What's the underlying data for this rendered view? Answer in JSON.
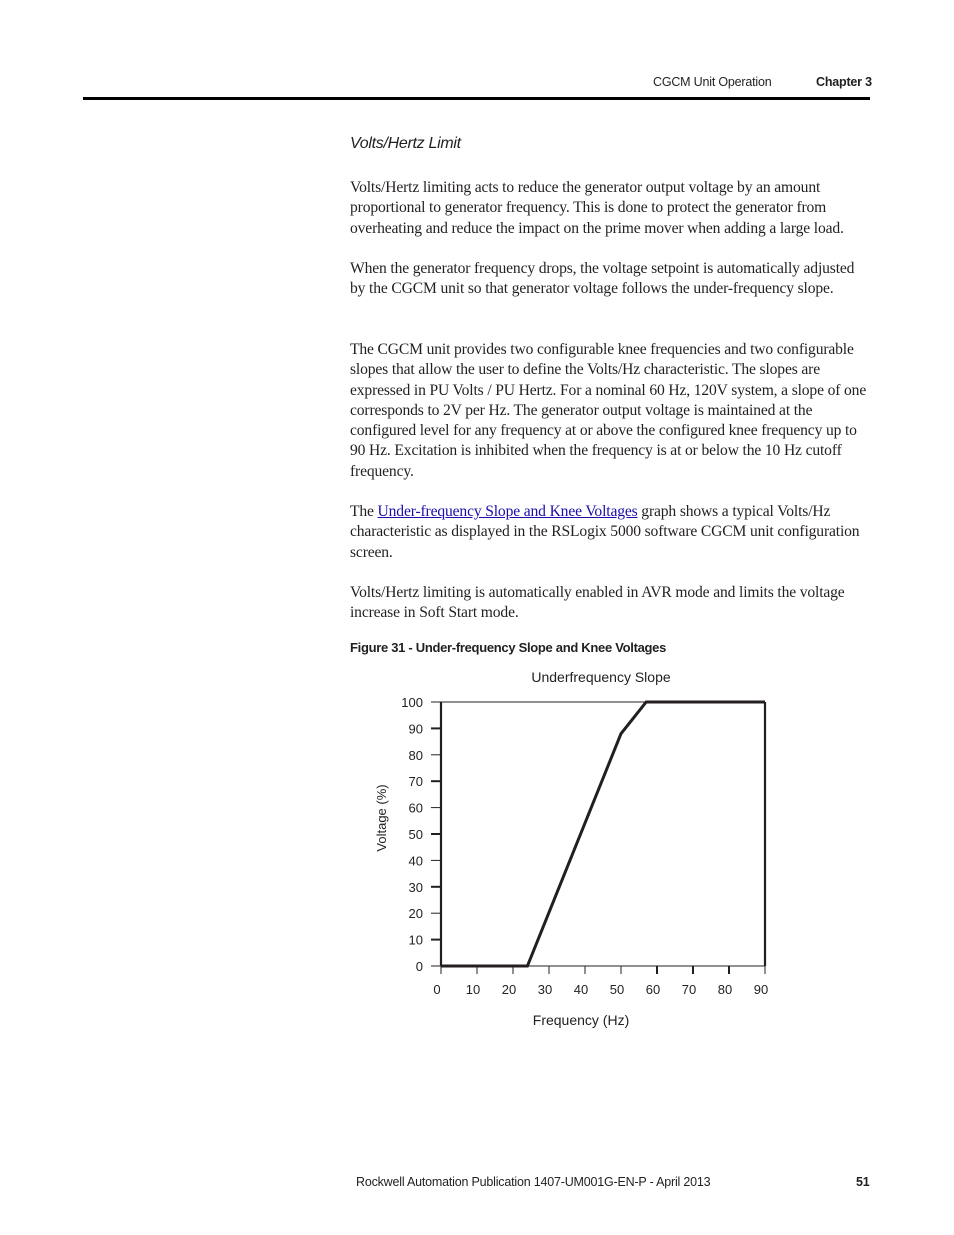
{
  "header": {
    "section": "CGCM Unit Operation",
    "chapter": "Chapter 3"
  },
  "content": {
    "section_title": "Volts/Hertz Limit",
    "paragraphs": [
      "Volts/Hertz limiting acts to reduce the generator output voltage by an amount proportional to generator frequency. This is done to protect the generator from overheating and reduce the impact on the prime mover when adding a large load.",
      "When the generator frequency drops, the voltage setpoint is automatically adjusted by the CGCM unit so that generator voltage follows the under-frequency slope.",
      "The CGCM unit provides two configurable knee frequencies and two configurable slopes that allow the user to define the Volts/Hz characteristic. The slopes are expressed in PU Volts / PU Hertz. For a nominal 60 Hz, 120V system, a slope of one corresponds to 2V per Hz. The generator output voltage is maintained at the configured level for any frequency at or above the configured knee frequency up to 90 Hz. Excitation is inhibited when the frequency is at or below the 10 Hz cutoff frequency.",
      {
        "prefix": "The ",
        "link": "Under-frequency Slope and Knee Voltages",
        "suffix": " graph shows a typical Volts/Hz characteristic as displayed in the RSLogix 5000 software CGCM unit configuration screen."
      },
      "Volts/Hertz limiting is automatically enabled in AVR mode and limits the voltage increase in Soft Start mode."
    ],
    "figure_caption": "Figure 31 - Under-frequency Slope and Knee Voltages"
  },
  "chart_data": {
    "type": "line",
    "title": "Underfrequency Slope",
    "xlabel": "Frequency (Hz)",
    "ylabel": "Voltage (%)",
    "xlim": [
      0,
      90
    ],
    "ylim": [
      0,
      100
    ],
    "x_ticks": [
      0,
      10,
      20,
      30,
      40,
      50,
      60,
      70,
      80,
      90
    ],
    "y_ticks": [
      0,
      10,
      20,
      30,
      40,
      50,
      60,
      70,
      80,
      90,
      100
    ],
    "grid": false,
    "legend": "none",
    "series": [
      {
        "name": "Underfrequency Slope",
        "x": [
          0,
          24,
          50,
          57,
          90
        ],
        "y": [
          0,
          0,
          88,
          100,
          100
        ]
      }
    ],
    "line_color": "#231f20"
  },
  "footer": {
    "publication": "Rockwell Automation Publication 1407-UM001G-EN-P - April 2013",
    "page_number": "51"
  }
}
